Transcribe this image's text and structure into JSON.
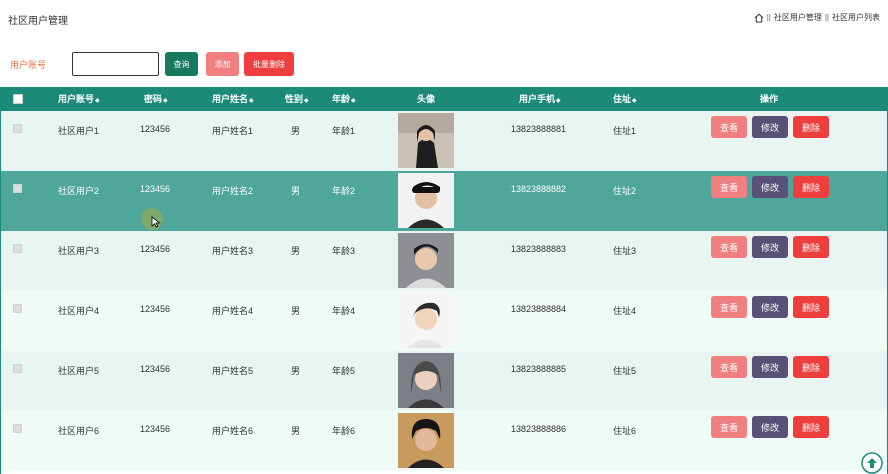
{
  "header": {
    "title": "社区用户管理",
    "breadcrumb": [
      "社区用户管理",
      "社区用户列表"
    ],
    "breadcrumb_sep": "||"
  },
  "search": {
    "label": "用户账号",
    "value": "",
    "placeholder": "",
    "query_label": "查询",
    "add_label": "添加",
    "batch_delete_label": "批量删除"
  },
  "table": {
    "columns": [
      "用户账号",
      "密码",
      "用户姓名",
      "性别",
      "年龄",
      "头像",
      "用户手机",
      "住址",
      "操作"
    ],
    "sort_icon": "◆",
    "actions": {
      "view": "查看",
      "edit": "修改",
      "delete": "删除"
    },
    "rows": [
      {
        "account": "社区用户1",
        "password": "123456",
        "name": "用户姓名1",
        "gender": "男",
        "age": "年龄1",
        "phone": "13823888881",
        "address": "住址1"
      },
      {
        "account": "社区用户2",
        "password": "123456",
        "name": "用户姓名2",
        "gender": "男",
        "age": "年龄2",
        "phone": "13823888882",
        "address": "住址2"
      },
      {
        "account": "社区用户3",
        "password": "123456",
        "name": "用户姓名3",
        "gender": "男",
        "age": "年龄3",
        "phone": "13823888883",
        "address": "住址3"
      },
      {
        "account": "社区用户4",
        "password": "123456",
        "name": "用户姓名4",
        "gender": "男",
        "age": "年龄4",
        "phone": "13823888884",
        "address": "住址4"
      },
      {
        "account": "社区用户5",
        "password": "123456",
        "name": "用户姓名5",
        "gender": "男",
        "age": "年龄5",
        "phone": "13823888885",
        "address": "住址5"
      },
      {
        "account": "社区用户6",
        "password": "123456",
        "name": "用户姓名6",
        "gender": "男",
        "age": "年龄6",
        "phone": "13823888886",
        "address": "住址6"
      }
    ]
  },
  "colors": {
    "header_bg": "#1b8a78",
    "hover_row": "#4fa69a",
    "query_btn": "#17795d",
    "view_btn": "#f08080",
    "edit_btn": "#5a5276",
    "delete_btn": "#ee3e3e",
    "label_orange": "#e8713a"
  },
  "icons": {
    "home": "home-icon",
    "scroll_top": "arrow-up-circle-icon",
    "cursor": "mouse-cursor-icon"
  }
}
